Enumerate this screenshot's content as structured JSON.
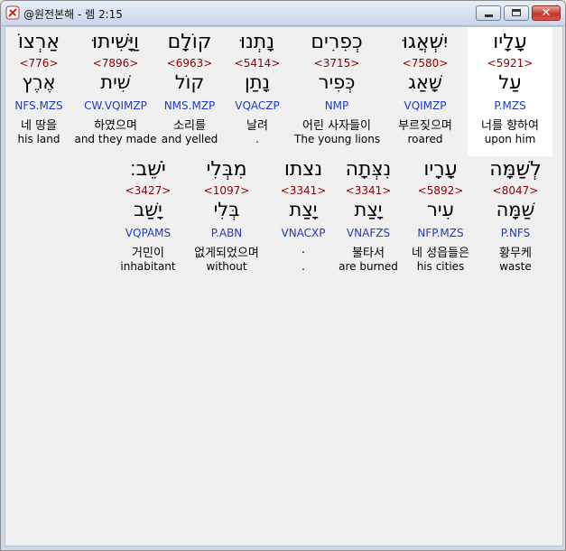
{
  "window": {
    "title": "@원전본해 - 렘 2:15",
    "min_label": "minimize",
    "max_label": "maximize",
    "close_label": "close"
  },
  "row1": [
    {
      "heb": "עָלָיו",
      "num": "<5921>",
      "root": "עַל",
      "code": "P.MZS",
      "ko": "너를 향하여",
      "en": "upon him"
    },
    {
      "heb": "יִשְׁאֲגוּ",
      "num": "<7580>",
      "root": "שָׁאַג",
      "code": "VQIMZP",
      "ko": "부르짖으며",
      "en": "roared"
    },
    {
      "heb": "כְפִרִים",
      "num": "<3715>",
      "root": "כְּפִיר",
      "code": "NMP",
      "ko": "어린 사자들이",
      "en": "The young lions"
    },
    {
      "heb": "נָתְנוּ",
      "num": "<5414>",
      "root": "נָתַן",
      "code": "VQACZP",
      "ko": "날려",
      "en": "."
    },
    {
      "heb": "קוֹלָם",
      "num": "<6963>",
      "root": "קוֹל",
      "code": "NMS.MZP",
      "ko": "소리를",
      "en": "and yelled"
    },
    {
      "heb": "וַיָּשִׁיתוּ",
      "num": "<7896>",
      "root": "שִׁית",
      "code": "CW.VQIMZP",
      "ko": "하였으며",
      "en": "and they made"
    },
    {
      "heb": "אַרְצוֹ",
      "num": "<776>",
      "root": "אֶרֶץ",
      "code": "NFS.MZS",
      "ko": "네 땅을",
      "en": "his land"
    }
  ],
  "row2": [
    {
      "heb": "לְשַׁמָּה",
      "num": "<8047>",
      "root": "שַׁמָּה",
      "code": "P.NFS",
      "ko": "황무케",
      "en": "waste"
    },
    {
      "heb": "עָרָיו",
      "num": "<5892>",
      "root": "עִיר",
      "code": "NFP.MZS",
      "ko": "네 성읍들은",
      "en": "his cities"
    },
    {
      "heb": "נִצְּתָה",
      "num": "<3341>",
      "root": "יָצַת",
      "code": "VNAFZS",
      "ko": "불타서",
      "en": "are burned"
    },
    {
      "heb": "נצתו",
      "num": "<3341>",
      "root": "יָצַת",
      "code": "VNACXP",
      "ko": ".",
      "en": "."
    },
    {
      "heb": "מִבְּלִי",
      "num": "<1097>",
      "root": "בְּלִי",
      "code": "P.ABN",
      "ko": "없게되었으며",
      "en": "without"
    },
    {
      "heb": "יֹשֵׁב׃",
      "num": "<3427>",
      "root": "יָשַׁב",
      "code": "VQPAMS",
      "ko": "거민이",
      "en": "inhabitant"
    }
  ]
}
